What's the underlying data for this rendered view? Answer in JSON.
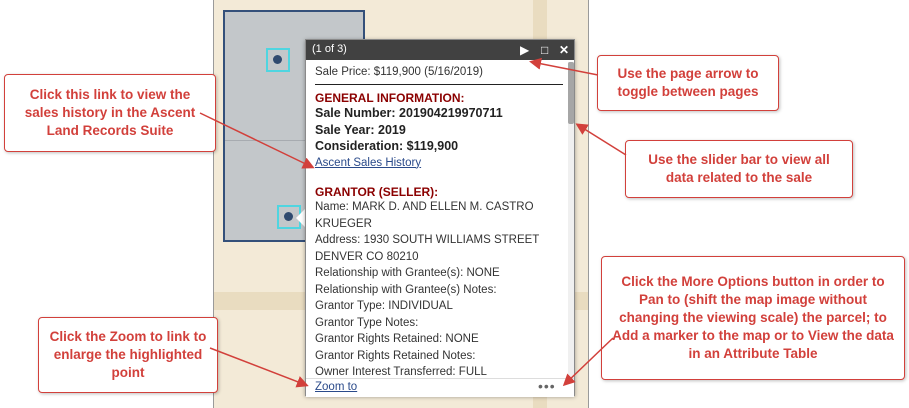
{
  "popup": {
    "page_count": "(1 of 3)",
    "sale_price": "Sale Price: $119,900 (5/16/2019)",
    "general_header": "GENERAL INFORMATION:",
    "sale_number": "Sale Number: 201904219970711",
    "sale_year": "Sale Year: 2019",
    "consideration": "Consideration: $119,900",
    "ascent_link": "Ascent Sales History",
    "grantor_header": "GRANTOR (SELLER):",
    "grantor_lines": [
      "Name: MARK D. AND ELLEN M. CASTRO",
      "KRUEGER",
      "Address: 1930 SOUTH WILLIAMS STREET",
      "DENVER CO 80210",
      "Relationship with Grantee(s): NONE",
      "Relationship with Grantee(s) Notes:",
      "Grantor Type: INDIVIDUAL",
      "Grantor Type Notes:",
      "Grantor Rights Retained: NONE",
      "Grantor Rights Retained Notes:",
      "Owner Interest Transferred: FULL"
    ],
    "zoom_link": "Zoom to",
    "more_options": "•••",
    "icons": {
      "next": "play-arrow-icon",
      "maximize": "maximize-icon",
      "close": "close-icon"
    }
  },
  "callouts": {
    "ascent": "Click this link to view the sales history in the Ascent Land Records Suite",
    "page_arrow": "Use the page arrow to toggle between pages",
    "slider": "Use the slider bar to view all data related to the sale",
    "zoom": "Click the Zoom to link to enlarge the highlighted point",
    "more_options": "Click the More Options button in order to Pan to (shift the map image without changing the viewing scale) the parcel; to Add a marker to the map or to View the data in an Attribute Table"
  },
  "colors": {
    "callout": "#d2403b",
    "section_header": "#8b0000",
    "link": "#2a4a8a",
    "highlight": "#4fd5e0"
  }
}
